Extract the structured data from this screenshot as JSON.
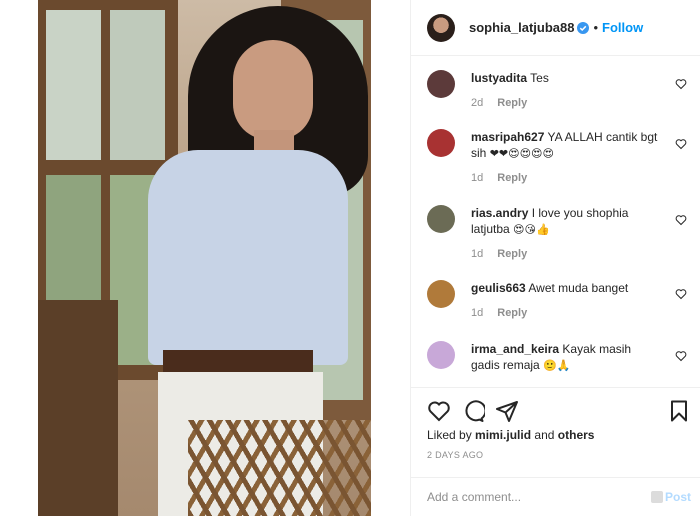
{
  "post": {
    "owner": {
      "username": "sophia_latjuba88",
      "verified": true,
      "follow_label": "Follow",
      "separator": "•"
    }
  },
  "comments": [
    {
      "username": "lustyadita",
      "text": "Tes",
      "age": "2d",
      "reply_label": "Reply",
      "avatar_color": "#5c3a3a"
    },
    {
      "username": "masripah627",
      "text": "YA ALLAH cantik bgt sih",
      "emoji": "❤❤😍😍😍😍",
      "age": "1d",
      "reply_label": "Reply",
      "avatar_color": "#a83232"
    },
    {
      "username": "rias.andry",
      "text": "I love you shophia latjutba",
      "emoji": "😍😘👍",
      "age": "1d",
      "reply_label": "Reply",
      "avatar_color": "#6b6b55"
    },
    {
      "username": "geulis663",
      "text": "Awet muda banget",
      "age": "1d",
      "reply_label": "Reply",
      "avatar_color": "#b07a3a"
    },
    {
      "username": "irma_and_keira",
      "text": "Kayak masih gadis remaja",
      "emoji": "🙂🙏",
      "age": "",
      "reply_label": "",
      "avatar_color": "#c8a8d8"
    }
  ],
  "likes": {
    "prefix": "Liked by",
    "user": "mimi.julid",
    "connector": "and",
    "others": "others"
  },
  "date": "2 DAYS AGO",
  "add_comment": {
    "placeholder": "Add a comment...",
    "post_label": "Post"
  },
  "icons": {
    "verified": "verified-badge-icon",
    "like": "heart-outline-icon",
    "comment": "comment-bubble-icon",
    "share": "paper-plane-icon",
    "save": "bookmark-icon"
  },
  "colors": {
    "link_blue": "#0095f6",
    "heart_red": "#e0245e",
    "muted": "#8e8e8e"
  }
}
